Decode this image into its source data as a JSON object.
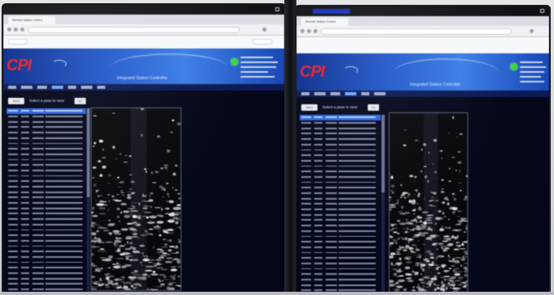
{
  "photo": {
    "kind": "photo of two monitors showing a satellite ground station web application"
  },
  "left": {
    "tab_title": "Remote Station Control",
    "url": "",
    "logo": "CPI",
    "app_name": "Integrated Station Controller",
    "select_button": "Select",
    "select_label": "Select a pass to view",
    "go_button": "Go",
    "bookmark_left": "",
    "bookmark_right": "",
    "image_title": "",
    "rows": 36,
    "selected_row": 0
  },
  "right": {
    "tab_title": "Remote Station Control",
    "url": "",
    "logo": "CPI",
    "app_name": "Integrated Station Controller",
    "select_button": "Select",
    "select_label": "Select a pass to view",
    "go_button": "Go",
    "image_title": "",
    "rows": 36,
    "selected_row": 0
  },
  "colors": {
    "banner": "#1f56c8",
    "logo": "#e5242b",
    "status_ok": "#3bd640",
    "list_selected": "#2a67e4",
    "app_background": "#04061a"
  }
}
